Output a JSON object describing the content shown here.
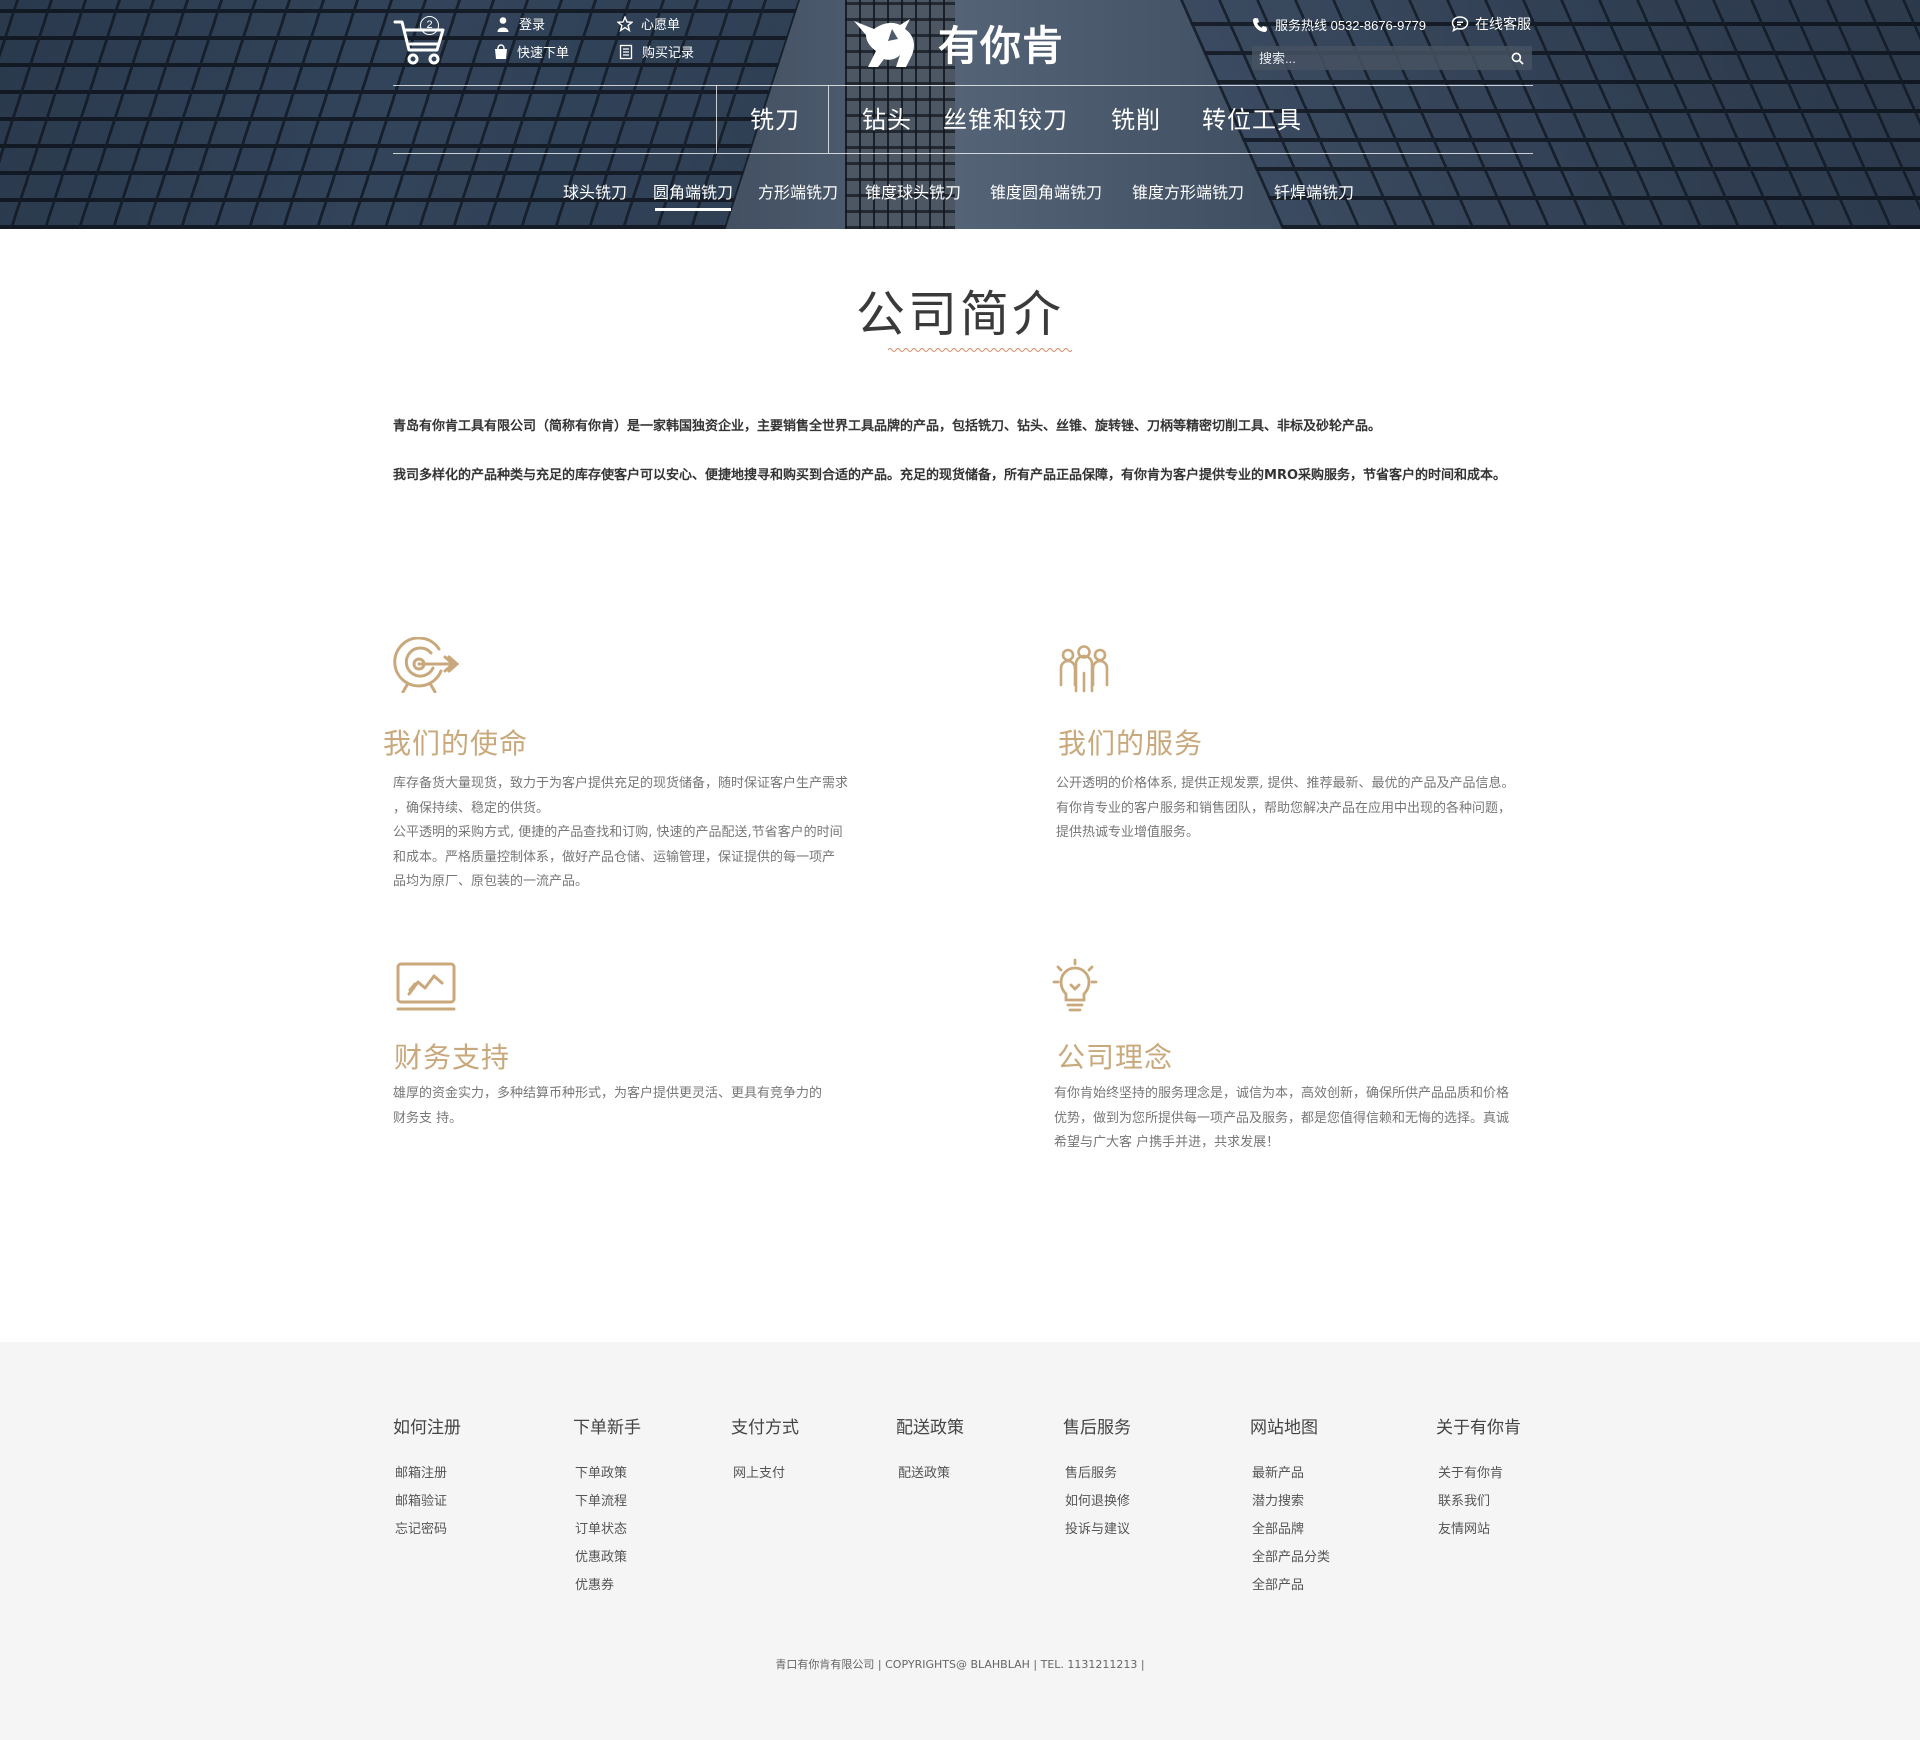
{
  "header": {
    "cart_count": "2",
    "login": "登录",
    "wishlist": "心愿单",
    "quick_order": "快速下单",
    "purchase_history": "购买记录",
    "brand_name": "有你肯",
    "hotline": "服务热线 0532-8676-9779",
    "online_service": "在线客服",
    "search_placeholder": "搜索..."
  },
  "main_categories": [
    "铣刀",
    "钻头",
    "丝锥和铰刀",
    "铣削",
    "转位工具"
  ],
  "sub_categories": [
    "球头铣刀",
    "圆角端铣刀",
    "方形端铣刀",
    "锥度球头铣刀",
    "锥度圆角端铣刀",
    "锥度方形端铣刀",
    "钎焊端铣刀"
  ],
  "active_sub_category": "圆角端铣刀",
  "page_title": "公司简介",
  "intro": [
    "青岛有你肯工具有限公司（简称有你肯）是一家韩国独资企业，主要销售全世界工具品牌的产品，包括铣刀、钻头、丝锥、旋转锉、刀柄等精密切削工具、非标及砂轮产品。",
    "我司多样化的产品种类与充足的库存使客户可以安心、便捷地搜寻和购买到合适的产品。充足的现货储备，所有产品正品保障，有你肯为客户提供专业的MRO采购服务，节省客户的时间和成本。"
  ],
  "features": [
    {
      "icon": "target-icon",
      "title": "我们的使命",
      "text": "库存备货大量现货，致力于为客户提供充足的现货储备，随时保证客户生产需求，确保持续、稳定的供货。\n公平透明的采购方式，便捷的产品查找和订购，快速的产品配送，节省客户的时间和成本。严格质量控制体系，做好产品仓储、运输管理，保证提供的每一项产品均为原厂、原包装的一流产品。"
    },
    {
      "icon": "team-icon",
      "title": "我们的服务",
      "text": "公开透明的价格体系，提供正规发票，提供、推荐最新、最优的产品及产品信息。\n有你肯专业的客户服务和销售团队，帮助您解决产品在应用中出现的各种问题，提供热诚专业增值服务。"
    },
    {
      "icon": "chart-icon",
      "title": "财务支持",
      "text": "雄厚的资金实力，多种结算币种形式，为客户提供更灵活、更具有竞争力的财务支 持。"
    },
    {
      "icon": "lightbulb-icon",
      "title": "公司理念",
      "text": "有你肯始终坚持的服务理念是，诚信为本，高效创新，确保所供产品品质和价格优势，做到为您所提供每一项产品及服务，都是您值得信赖和无悔的选择。真诚希望与广大客 户携手并进，共求发展！"
    }
  ],
  "footer": {
    "columns": [
      {
        "title": "如何注册",
        "links": [
          "邮箱注册",
          "邮箱验证",
          "忘记密码"
        ]
      },
      {
        "title": "下单新手",
        "links": [
          "下单政策",
          "下单流程",
          "订单状态",
          "优惠政策",
          "优惠券"
        ]
      },
      {
        "title": "支付方式",
        "links": [
          "网上支付"
        ]
      },
      {
        "title": "配送政策",
        "links": [
          "配送政策"
        ]
      },
      {
        "title": "售后服务",
        "links": [
          "售后服务",
          "如何退换修",
          "投诉与建议"
        ]
      },
      {
        "title": "网站地图",
        "links": [
          "最新产品",
          "潜力搜索",
          "全部品牌",
          "全部产品分类",
          "全部产品"
        ]
      },
      {
        "title": "关于有你肯",
        "links": [
          "关于有你肯",
          "联系我们",
          "友情网站"
        ]
      }
    ],
    "copyright": "青口有你肯有限公司 | COPYRIGHTS@ BLAHBLAH | TEL. 1131211213 |"
  },
  "colors": {
    "accent": "#c9a87c",
    "footer_bg": "#f5f5f5",
    "title_wave": "#d18a66"
  }
}
